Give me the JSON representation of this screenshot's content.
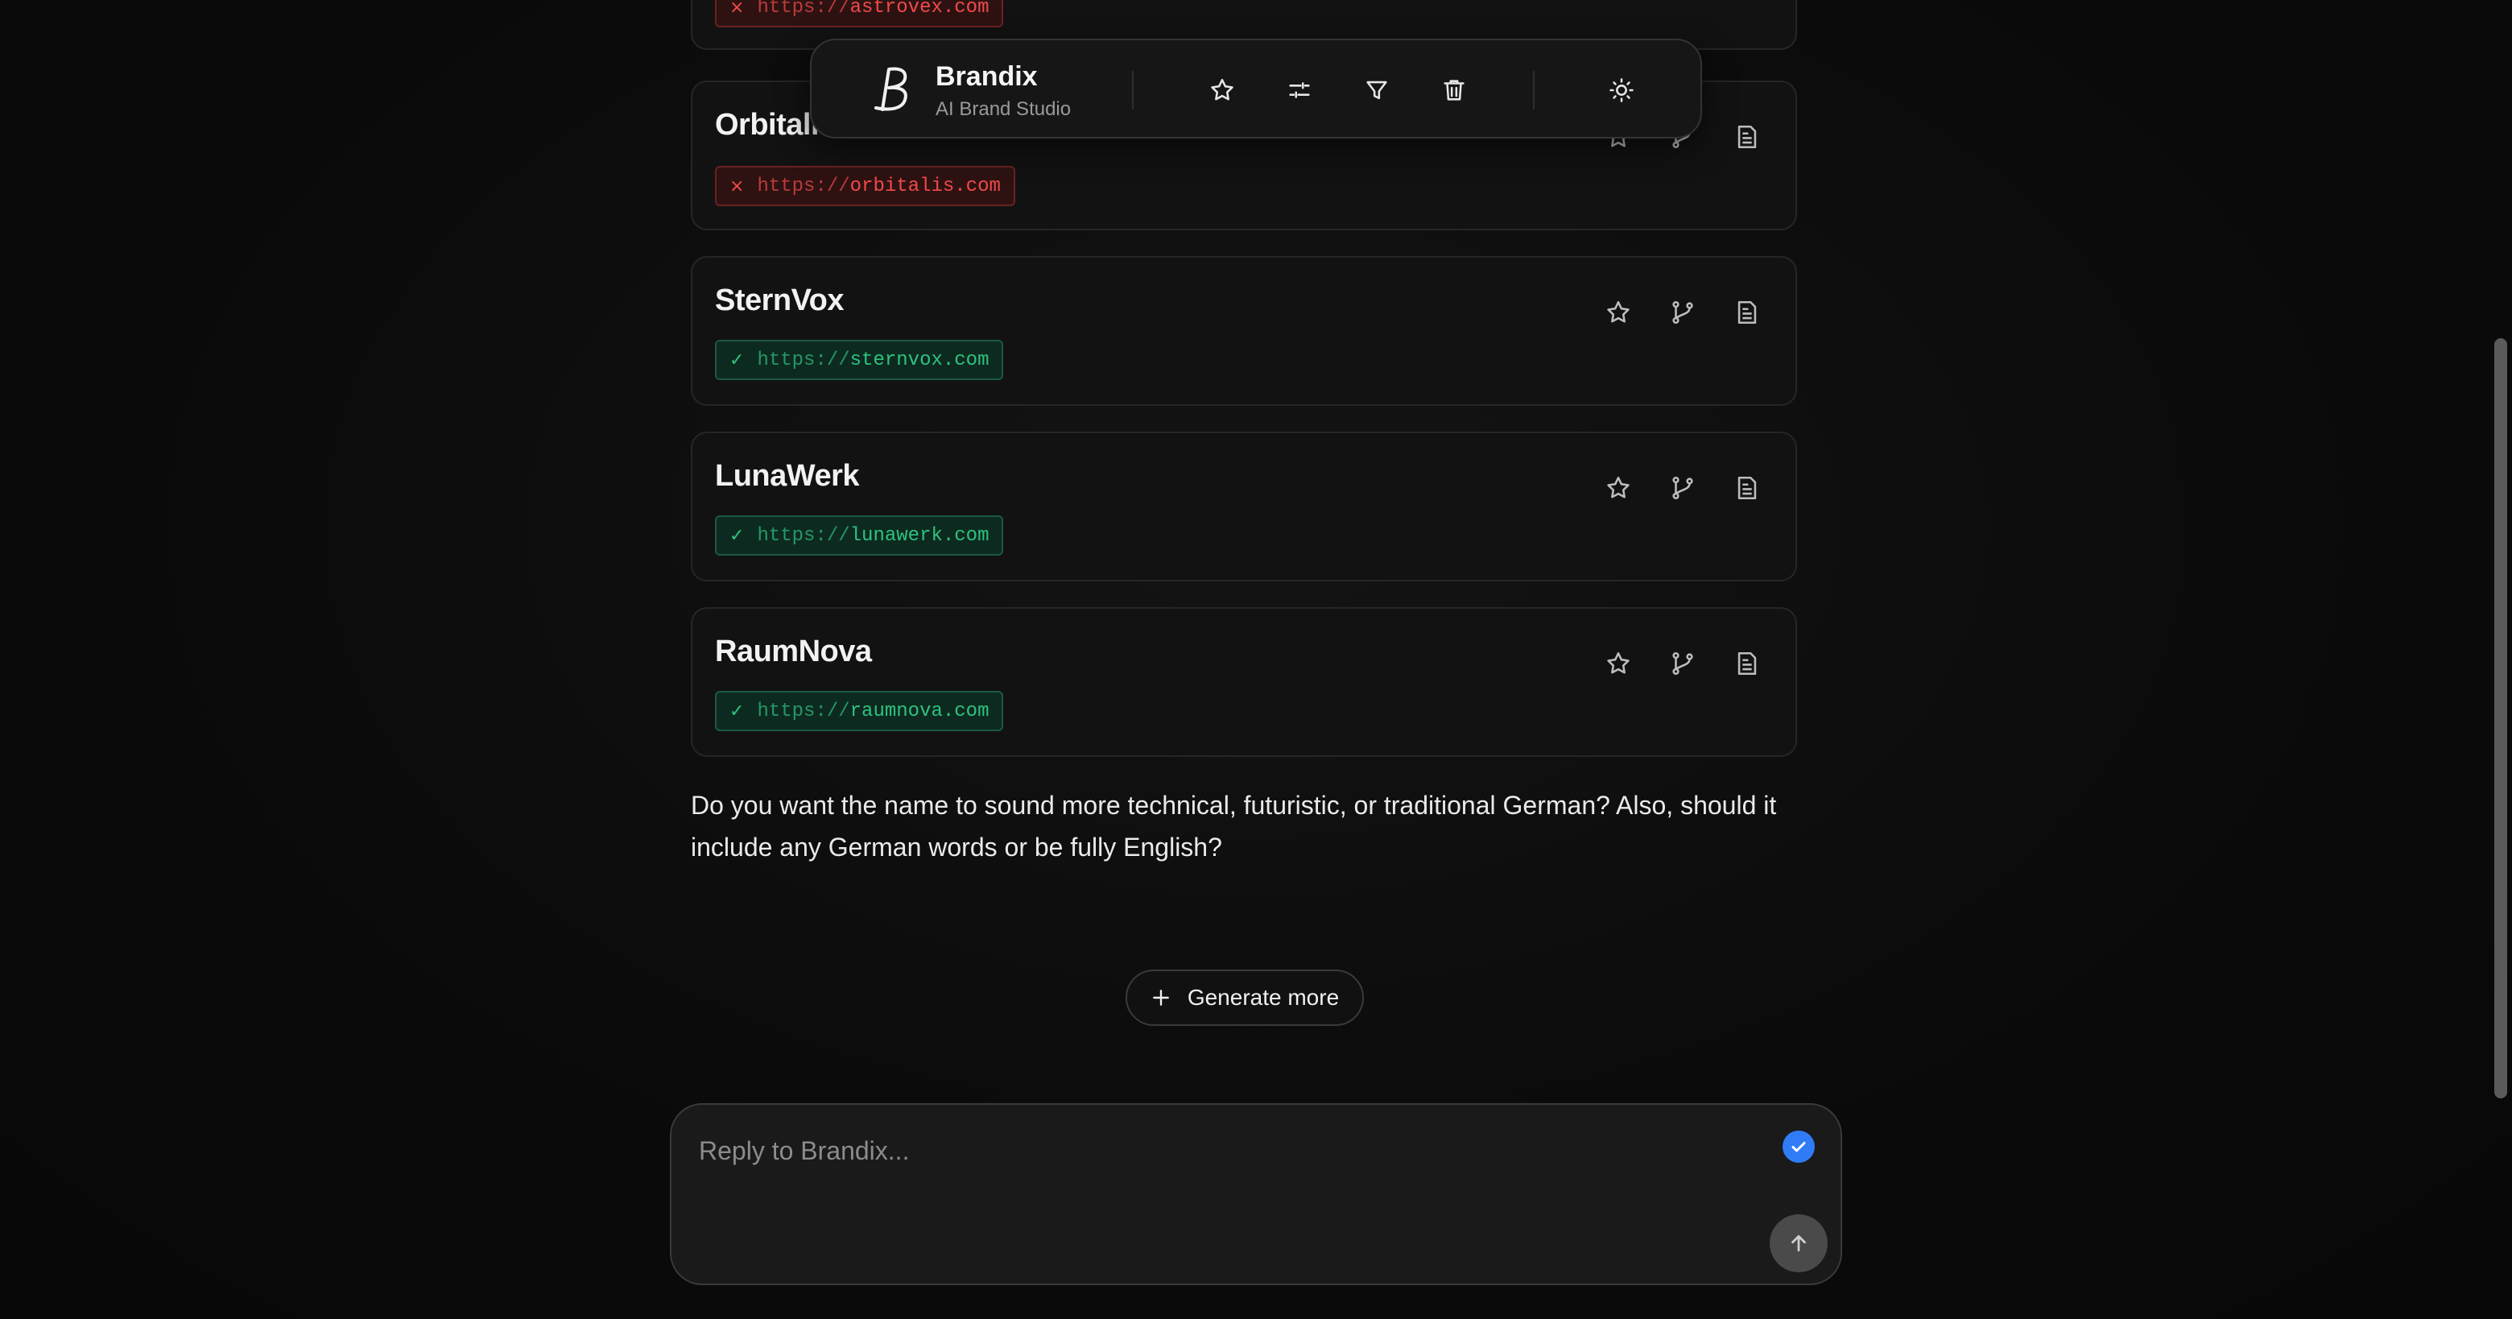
{
  "brand": {
    "name": "Brandix",
    "subtitle": "AI Brand Studio"
  },
  "toolbar": {
    "icons": [
      "star-icon",
      "sliders-icon",
      "filter-icon",
      "trash-icon",
      "sun-icon"
    ]
  },
  "names": [
    {
      "name": "",
      "scheme": "https://",
      "domain": "astrovex.com",
      "status": "unavailable",
      "mark": "×"
    },
    {
      "name": "Orbitalis",
      "scheme": "https://",
      "domain": "orbitalis.com",
      "status": "unavailable",
      "mark": "×"
    },
    {
      "name": "SternVox",
      "scheme": "https://",
      "domain": "sternvox.com",
      "status": "available",
      "mark": "✓"
    },
    {
      "name": "LunaWerk",
      "scheme": "https://",
      "domain": "lunawerk.com",
      "status": "available",
      "mark": "✓"
    },
    {
      "name": "RaumNova",
      "scheme": "https://",
      "domain": "raumnova.com",
      "status": "available",
      "mark": "✓"
    }
  ],
  "card_actions": [
    "star-icon",
    "branch-icon",
    "document-icon"
  ],
  "message": {
    "question": "Do you want the name to sound more technical, futuristic, or traditional German? Also, should it include any German words or be fully English?"
  },
  "generate_more": {
    "label": "Generate more"
  },
  "reply": {
    "placeholder": "Reply to Brandix..."
  },
  "colors": {
    "available": "#2ec27e",
    "unavailable": "#f04a4a",
    "accent": "#2f7cf6"
  }
}
